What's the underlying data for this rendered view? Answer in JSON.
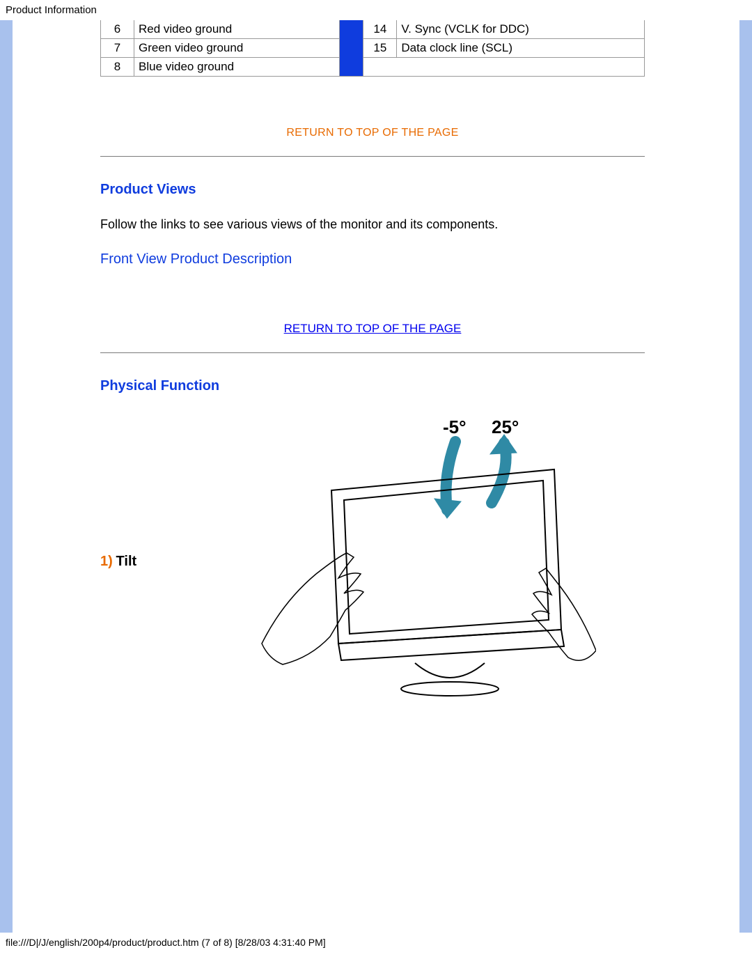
{
  "header": {
    "title": "Product Information"
  },
  "pin_table": {
    "left": [
      {
        "num": "6",
        "desc": "Red video ground"
      },
      {
        "num": "7",
        "desc": "Green video ground"
      },
      {
        "num": "8",
        "desc": "Blue video ground"
      }
    ],
    "right": [
      {
        "num": "14",
        "desc": "V. Sync (VCLK for DDC)"
      },
      {
        "num": "15",
        "desc": "Data clock line (SCL)"
      }
    ]
  },
  "return_top": "RETURN TO TOP OF THE PAGE",
  "sections": {
    "product_views": {
      "heading": "Product Views",
      "body": "Follow the links to see various views of the monitor and its components.",
      "link": "Front View Product Description"
    },
    "physical_function": {
      "heading": "Physical Function",
      "tilt": {
        "num": "1)",
        "label": "Tilt",
        "angle_min": "-5°",
        "angle_max": "25°"
      }
    }
  },
  "footer": {
    "path": "file:///D|/J/english/200p4/product/product.htm (7 of 8) [8/28/03 4:31:40 PM]"
  }
}
